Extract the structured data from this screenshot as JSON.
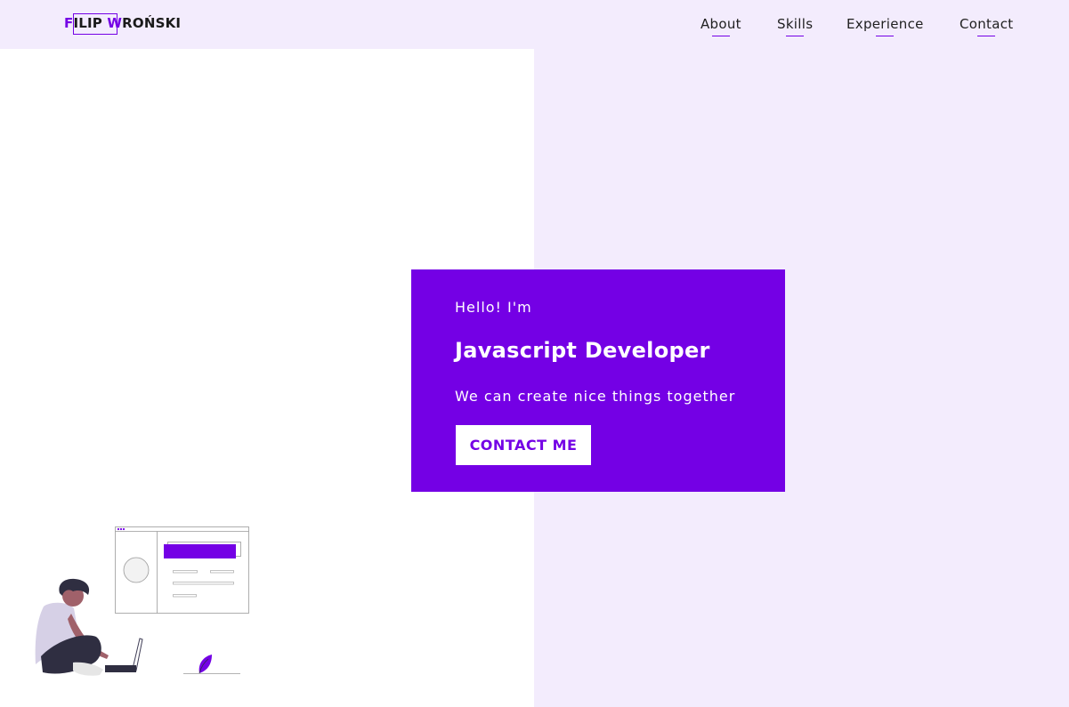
{
  "header": {
    "logo": {
      "first_initial": "F",
      "first_rest": "ILIP ",
      "last_initial": "W",
      "last_rest": "ROŃSKI"
    },
    "nav": [
      {
        "label": "About"
      },
      {
        "label": "Skills"
      },
      {
        "label": "Experience"
      },
      {
        "label": "Contact"
      }
    ]
  },
  "hero": {
    "greeting": "Hello! I'm",
    "role": "Javascript Developer",
    "tagline": "We can create nice things together",
    "cta_label": "CONTACT ME"
  },
  "colors": {
    "accent": "#7400e5",
    "right_background": "#f3ecfd",
    "card_text": "#ffffff"
  },
  "illustration": {
    "name": "developer-with-laptop-illustration"
  }
}
